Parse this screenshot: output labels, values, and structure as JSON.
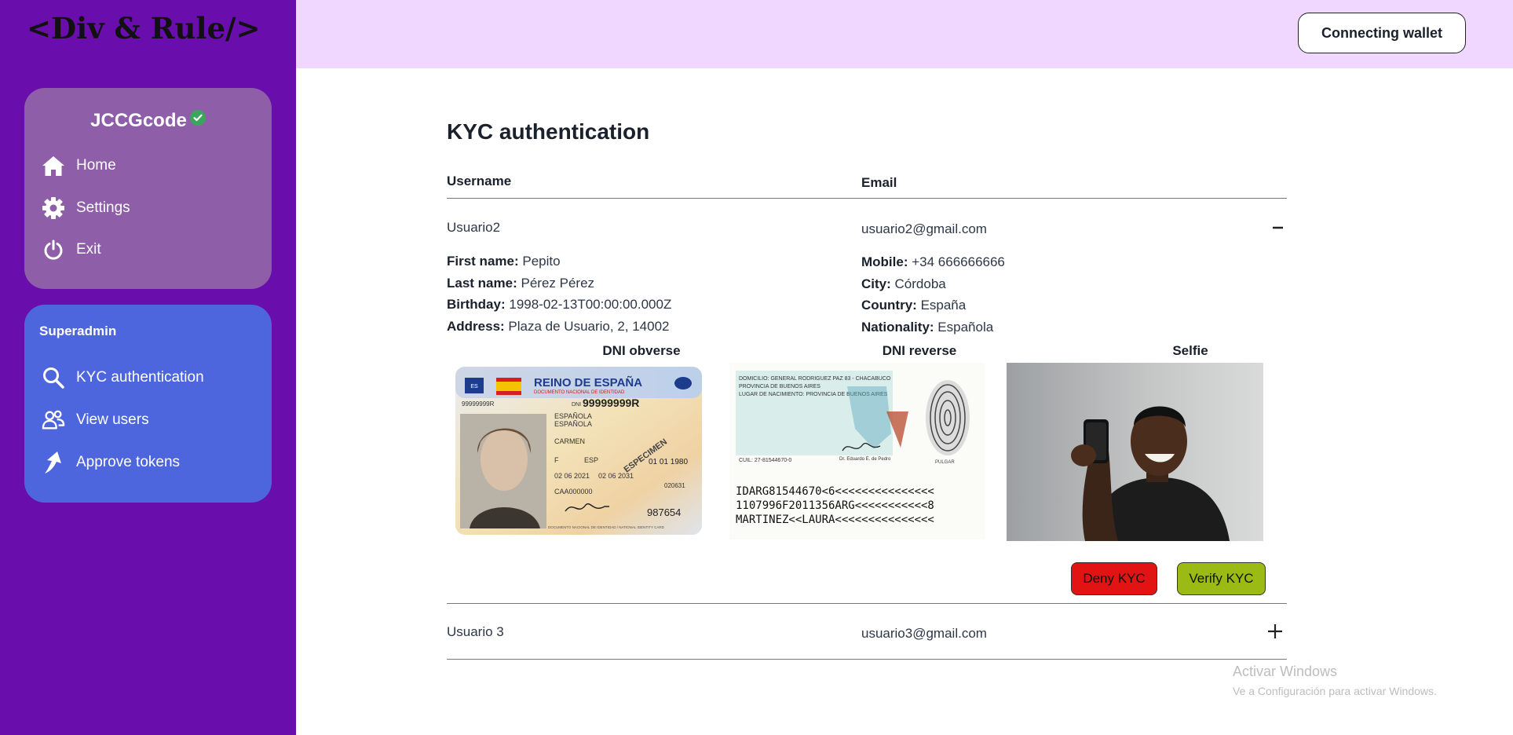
{
  "logo": "<Div & Rule/>",
  "user_card": {
    "username": "JCCGcode",
    "items": [
      {
        "label": "Home",
        "icon": "home-icon"
      },
      {
        "label": "Settings",
        "icon": "gear-icon"
      },
      {
        "label": "Exit",
        "icon": "power-icon"
      }
    ]
  },
  "admin_card": {
    "title": "Superadmin",
    "items": [
      {
        "label": "KYC authentication",
        "icon": "search-icon"
      },
      {
        "label": "View users",
        "icon": "users-icon"
      },
      {
        "label": "Approve tokens",
        "icon": "arrow-up-icon"
      }
    ]
  },
  "header": {
    "wallet_button": "Connecting wallet"
  },
  "main": {
    "title": "KYC authentication",
    "columns": [
      "Username",
      "Email"
    ],
    "rows": [
      {
        "username": "Usuario2",
        "email": "usuario2@gmail.com",
        "expanded": true,
        "left_details": [
          {
            "label": "First name:",
            "value": "Pepito"
          },
          {
            "label": "Last name:",
            "value": "Pérez Pérez"
          },
          {
            "label": "Birthday:",
            "value": "1998-02-13T00:00:00.000Z"
          },
          {
            "label": "Address:",
            "value": "Plaza de Usuario, 2, 14002"
          }
        ],
        "right_details": [
          {
            "label": "Mobile:",
            "value": "+34 666666666"
          },
          {
            "label": "City:",
            "value": "Córdoba"
          },
          {
            "label": "Country:",
            "value": "España"
          },
          {
            "label": "Nationality:",
            "value": "Española"
          }
        ],
        "documents": [
          {
            "title": "DNI obverse"
          },
          {
            "title": "DNI reverse"
          },
          {
            "title": "Selfie"
          }
        ],
        "dni_obverse": {
          "country": "ES",
          "heading": "REINO DE ESPAÑA",
          "subheading": "DOCUMENTO NACIONAL DE IDENTIDAD",
          "dni_prefix": "DNI",
          "number": "99999999R",
          "left_number": "99999999R",
          "surname1": "ESPAÑOLA",
          "surname2": "ESPAÑOLA",
          "name": "CARMEN",
          "sex": "F",
          "nationality": "ESP",
          "birth": "01 01 1980",
          "issue": "02 06 2021",
          "expiry": "02 06 2031",
          "support": "CAA000000",
          "can": "987654",
          "code": "020631",
          "stamp": "ESPECIMEN",
          "footer": "DOCUMENTO NACIONAL DE IDENTIDAD / NATIONAL IDENTITY CARD"
        },
        "dni_reverse": {
          "line1": "DOMICILIO: GENERAL RODRIGUEZ PAZ 83 - CHACABUCO",
          "line2": "PROVINCIA DE BUENOS AIRES",
          "line3": "LUGAR DE NACIMIENTO: PROVINCIA DE BUENOS AIRES",
          "cuil": "CUIL: 27-81544670-0",
          "signature_caption": "Dr. Eduardo E. de Pedro",
          "thumb": "PULGAR",
          "mrz": [
            "IDARG81544670<6<<<<<<<<<<<<<<<",
            "1107996F2011356ARG<<<<<<<<<<<8",
            "MARTINEZ<<LAURA<<<<<<<<<<<<<<<"
          ]
        },
        "actions": {
          "deny": "Deny KYC",
          "verify": "Verify KYC"
        }
      },
      {
        "username": "Usuario 3",
        "email": "usuario3@gmail.com",
        "expanded": false
      }
    ]
  },
  "watermark": {
    "line1": "Activar Windows",
    "line2": "Ve a Configuración para activar Windows."
  }
}
